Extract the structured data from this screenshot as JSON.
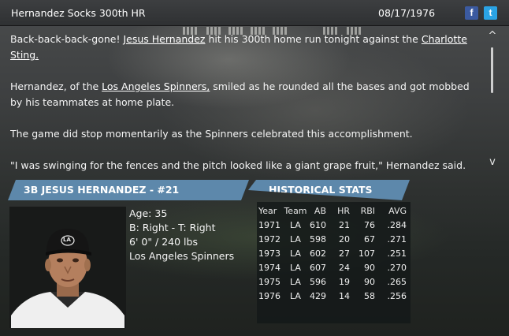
{
  "header": {
    "headline": "Hernandez Socks 300th HR",
    "date": "08/17/1976",
    "social": [
      {
        "name": "facebook",
        "glyph": "f"
      },
      {
        "name": "twitter",
        "glyph": "t"
      }
    ]
  },
  "article": {
    "p1_pre": "Back-back-back-gone! ",
    "p1_link1": "Jesus Hernandez",
    "p1_mid": " hit his 300th home run tonight against the ",
    "p1_link2": "Charlotte Sting.",
    "p2_pre": "Hernandez, of the ",
    "p2_link": "Los Angeles Spinners,",
    "p2_post": " smiled as he rounded all the bases and got mobbed by his teammates at home plate.",
    "p3": "The game did stop momentarily as the Spinners celebrated this accomplishment.",
    "p4": "\"I was swinging for the fences and the pitch looked like a giant grape fruit,\" Hernandez said.",
    "scroll_up": "^",
    "scroll_down": "v"
  },
  "player": {
    "banner": "3B JESUS HERNANDEZ - #21",
    "age": "Age: 35",
    "bats_throws": "B: Right - T: Right",
    "height_weight": "6' 0\" / 240 lbs",
    "team": "Los Angeles Spinners",
    "cap_logo": "LA"
  },
  "stats": {
    "banner": "HISTORICAL STATS",
    "headers": [
      "Year",
      "Team",
      "AB",
      "HR",
      "RBI",
      "AVG"
    ],
    "rows": [
      [
        "1971",
        "LA",
        "610",
        "21",
        "76",
        ".284"
      ],
      [
        "1972",
        "LA",
        "598",
        "20",
        "67",
        ".271"
      ],
      [
        "1973",
        "LA",
        "602",
        "27",
        "107",
        ".251"
      ],
      [
        "1974",
        "LA",
        "607",
        "24",
        "90",
        ".270"
      ],
      [
        "1975",
        "LA",
        "596",
        "19",
        "90",
        ".265"
      ],
      [
        "1976",
        "LA",
        "429",
        "14",
        "58",
        ".256"
      ]
    ]
  },
  "colors": {
    "banner": "#5d88ab",
    "facebook": "#3b5aa0",
    "twitter": "#2aa3e4"
  }
}
